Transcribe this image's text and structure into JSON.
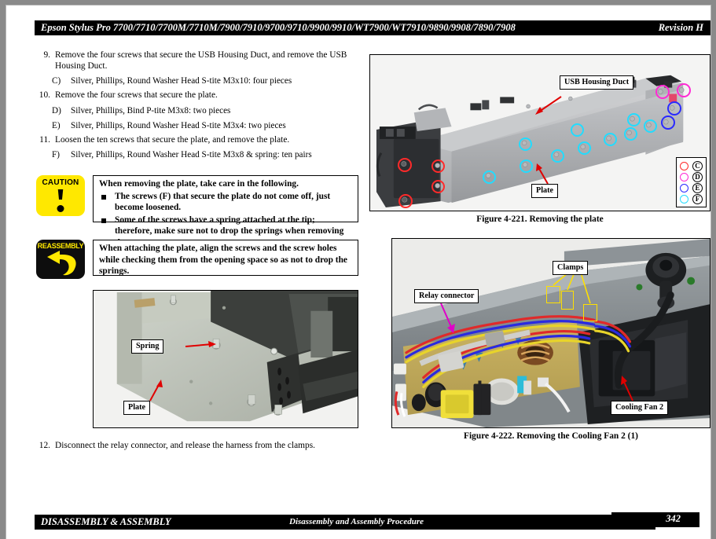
{
  "header": {
    "title": "Epson Stylus Pro 7700/7710/7700M/7710M/7900/7910/9700/9710/9900/9910/WT7900/WT7910/9890/9908/7890/7908",
    "revision": "Revision H"
  },
  "footer": {
    "left": "DISASSEMBLY & ASSEMBLY",
    "center": "Disassembly and Assembly Procedure",
    "page": "342"
  },
  "steps": [
    {
      "num": "9.",
      "text": "Remove the four screws that secure the USB Housing Duct, and remove the USB Housing Duct.",
      "substeps": [
        {
          "label": "C)",
          "text": "Silver, Phillips, Round Washer Head S-tite M3x10: four pieces"
        }
      ]
    },
    {
      "num": "10.",
      "text": "Remove the four screws that secure the plate.",
      "substeps": [
        {
          "label": "D)",
          "text": "Silver, Phillips, Bind P-tite M3x8: two pieces"
        },
        {
          "label": "E)",
          "text": "Silver, Phillips, Round Washer Head S-tite M3x4: two pieces"
        }
      ]
    },
    {
      "num": "11.",
      "text": "Loosen the ten screws that secure the plate, and remove the plate.",
      "substeps": [
        {
          "label": "F)",
          "text": "Silver, Phillips, Round Washer Head S-tite M3x8 & spring: ten pairs"
        }
      ]
    }
  ],
  "step12": {
    "num": "12.",
    "text": "Disconnect the relay connector, and release the harness from the clamps."
  },
  "caution": {
    "icon_label": "CAUTION",
    "lead": "When removing the plate, take care in the following.",
    "bullets": [
      "The screws (F) that secure the plate do not come off, just become loosened.",
      "Some of the screws have a spring attached at the tip; therefore, make sure not to drop the springs when removing those screws."
    ]
  },
  "reassembly": {
    "icon_label": "REASSEMBLY",
    "text": "When attaching the plate, align the screws and the screw holes while checking them from the opening space so as not to drop the springs."
  },
  "figure_plate_photo": {
    "callouts": [
      {
        "label": "Spring"
      },
      {
        "label": "Plate"
      }
    ]
  },
  "figure_4_221": {
    "caption": "Figure 4-221.  Removing the plate",
    "callouts": [
      {
        "label": "USB Housing Duct"
      },
      {
        "label": "Plate"
      }
    ],
    "legend": [
      {
        "letter": "C",
        "color": "#ff2a2a"
      },
      {
        "letter": "D",
        "color": "#ff2ad4"
      },
      {
        "letter": "E",
        "color": "#2a2aff"
      },
      {
        "letter": "F",
        "color": "#22dcff"
      }
    ]
  },
  "figure_4_222": {
    "caption": "Figure 4-222.  Removing the Cooling Fan 2 (1)",
    "callouts": [
      {
        "label": "Clamps"
      },
      {
        "label": "Relay connector"
      },
      {
        "label": "Cooling Fan 2"
      }
    ]
  },
  "colors": {
    "header_bg": "#000000",
    "caution_yellow": "#ffe800",
    "arrow_red": "#e00000",
    "arrow_magenta": "#e000c8",
    "clamp_yellow": "#ffe000"
  }
}
